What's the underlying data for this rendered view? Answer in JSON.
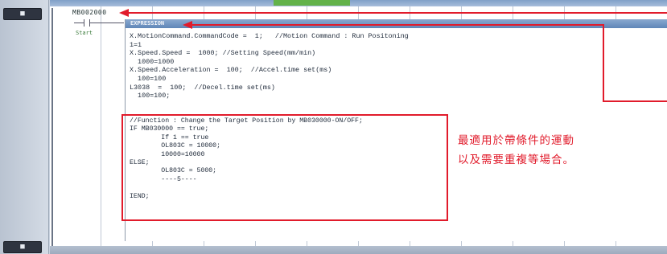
{
  "gutter": {
    "rung_buttons": [
      "■",
      "■"
    ]
  },
  "contact": {
    "address": "MB002000",
    "label": "Start"
  },
  "expression": {
    "title": "EXPRESSION",
    "lines_top": [
      "X.MotionCommand.CommandCode =  1;   //Motion Command : Run Positoning",
      "1=1",
      "X.Speed.Speed =  1000; //Setting Speed(mm/min)",
      "  1000=1000",
      "X.Speed.Acceleration =  100;  //Accel.time set(ms)",
      "  100=100",
      "L3038  =  100;  //Decel.time set(ms)",
      "  100=100;"
    ],
    "lines_bottom": [
      "//Function : Change the Target Position by MB030000-ON/OFF;",
      "IF MB030000 == true;",
      "        If 1 == true",
      "        OL803C = 10000;",
      "        10000=10000",
      "ELSE;",
      "        OL803C = 5000;",
      "        ----5----",
      "",
      "IEND;"
    ]
  },
  "annotation": {
    "caption_line1": "最適用於帶條件的運動",
    "caption_line2": "以及需要重複等場合。",
    "color": "#e11b2b"
  }
}
